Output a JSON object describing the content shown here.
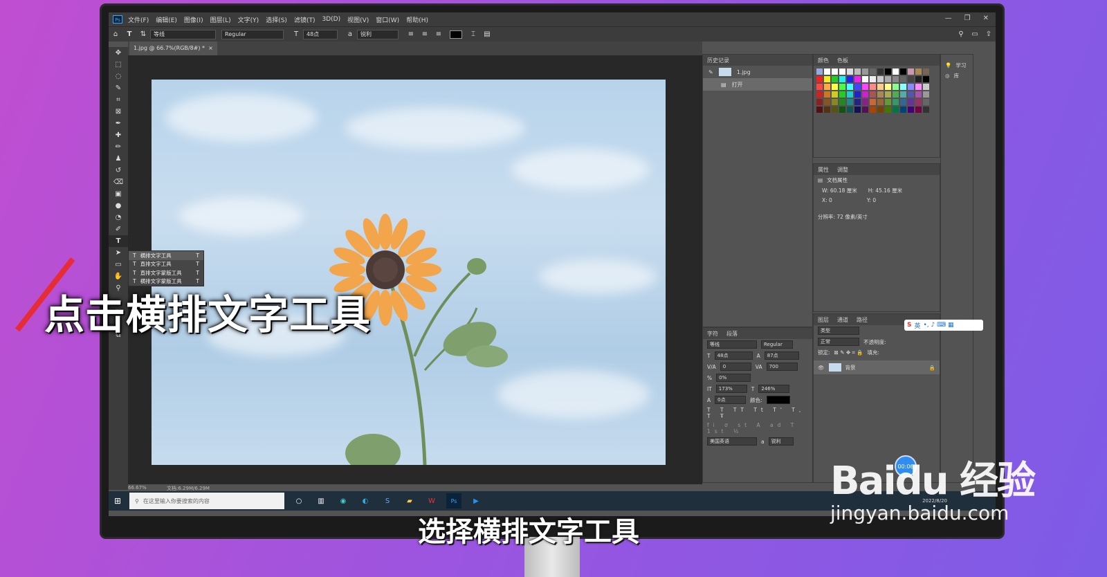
{
  "menubar": {
    "app_icon": "Ps",
    "items": [
      "文件(F)",
      "编辑(E)",
      "图像(I)",
      "图层(L)",
      "文字(Y)",
      "选择(S)",
      "滤镜(T)",
      "3D(D)",
      "视图(V)",
      "窗口(W)",
      "帮助(H)"
    ]
  },
  "options": {
    "font_family": "等线",
    "font_style": "Regular",
    "font_size": "48点",
    "anti_alias": "锐利",
    "text_color": "#000000"
  },
  "document_tab": "1.jpg @ 66.7%(RGB/8#) *",
  "flyout": {
    "items": [
      {
        "label": "横排文字工具",
        "key": "T"
      },
      {
        "label": "直排文字工具",
        "key": "T"
      },
      {
        "label": "直排文字蒙版工具",
        "key": "T"
      },
      {
        "label": "横排文字蒙版工具",
        "key": "T"
      }
    ]
  },
  "history": {
    "tab": "历史记录",
    "file": "1.jpg",
    "step": "打开"
  },
  "swatches_panel": {
    "tabs": [
      "颜色",
      "色板"
    ]
  },
  "properties": {
    "tabs": [
      "属性",
      "调整"
    ],
    "title": "文档属性",
    "w": "W: 60.18 厘米",
    "h": "H: 45.16 厘米",
    "x": "X: 0",
    "y": "Y: 0",
    "resolution": "分辨率: 72 像素/英寸"
  },
  "learn": {
    "label": "学习",
    "lib": "库"
  },
  "character": {
    "tabs": [
      "字符",
      "段落"
    ],
    "font": "等线",
    "style": "Regular",
    "size": "48点",
    "leading": "87点",
    "kerning": "0",
    "tracking": "700",
    "scale_v_pct": "0%",
    "scale_v": "173%",
    "scale_h": "246%",
    "baseline": "0点",
    "color_label": "颜色:",
    "language": "美国英语",
    "aa": "锐利"
  },
  "layers": {
    "tabs": [
      "图层",
      "通道",
      "路径"
    ],
    "search": "类型",
    "mode": "正常",
    "opacity": "不透明度:",
    "lock": "锁定:",
    "fill": "填充:",
    "layer_name": "背景"
  },
  "statusbar": {
    "zoom": "66.67%",
    "doc": "文档:6.29M/6.29M"
  },
  "taskbar": {
    "search_placeholder": "在这里输入你要搜索的内容",
    "ime": "英",
    "date": "2022/8/20"
  },
  "timer": "00:06",
  "overlay_title": "点击横排文字工具",
  "subtitle": "选择横排文字工具",
  "watermark": {
    "logo": "Baidu 经验",
    "url": "jingyan.baidu.com"
  }
}
